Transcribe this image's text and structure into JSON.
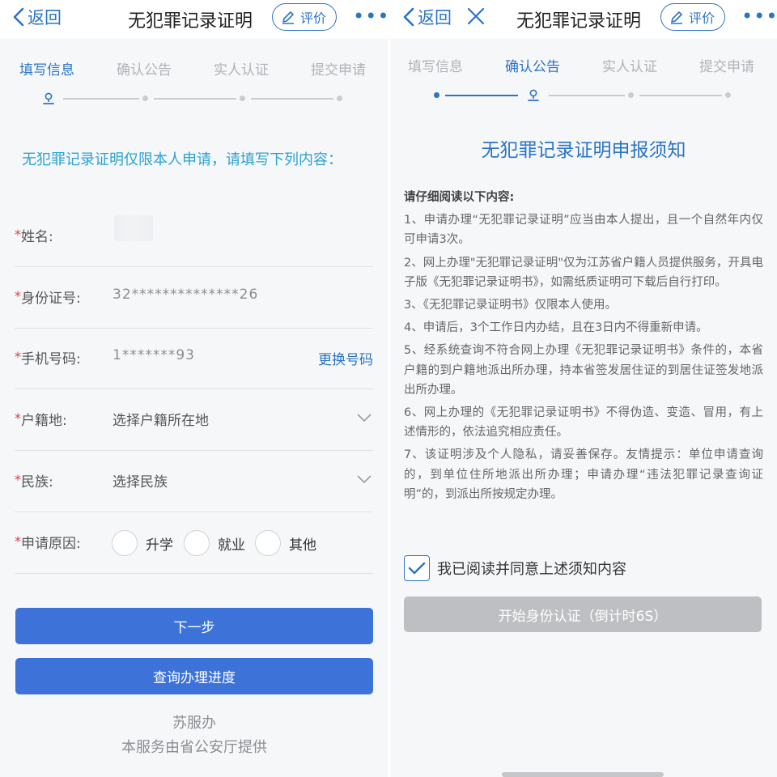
{
  "left": {
    "nav": {
      "back_label": "返回",
      "title": "无犯罪记录证明",
      "rate_label": "评价",
      "more_label": "•••"
    },
    "steps": [
      "填写信息",
      "确认公告",
      "实人认证",
      "提交申请"
    ],
    "intro": "无犯罪记录证明仅限本人申请，请填写下列内容：",
    "form": {
      "required_mark": "*",
      "name_label": "姓名:",
      "id_label": "身份证号:",
      "id_value": "32**************26",
      "phone_label": "手机号码:",
      "phone_value": "1*******93",
      "change_phone": "更换号码",
      "household_label": "户籍地:",
      "household_placeholder": "选择户籍所在地",
      "ethnic_label": "民族:",
      "ethnic_placeholder": "选择民族",
      "reason_label": "申请原因:",
      "reason_options": [
        "升学",
        "就业",
        "其他"
      ]
    },
    "next_button": "下一步",
    "progress_button": "查询办理进度",
    "footer_brand": "苏服办",
    "footer_note": "本服务由省公安厅提供"
  },
  "right": {
    "nav": {
      "back_label": "返回",
      "title": "无犯罪记录证明",
      "rate_label": "评价",
      "more_label": "•••"
    },
    "steps": [
      "填写信息",
      "确认公告",
      "实人认证",
      "提交申请"
    ],
    "notice_title": "无犯罪记录证明申报须知",
    "notice_heading": "请仔细阅读以下内容:",
    "notice_items": [
      "1、申请办理“无犯罪记录证明”应当由本人提出，且一个自然年内仅可申请3次。",
      "2、网上办理\"无犯罪记录证明\"仅为江苏省户籍人员提供服务，开具电子版《无犯罪记录证明书》，如需纸质证明可下载后自行打印。",
      "3、《无犯罪记录证明书》仅限本人使用。",
      "4、申请后，3个工作日内办结，且在3日内不得重新申请。",
      "5、经系统查询不符合网上办理《无犯罪记录证明书》条件的，本省户籍的到户籍地派出所办理，持本省签发居住证的到居住证签发地派出所办理。",
      "6、网上办理的《无犯罪记录证明书》不得伪造、变造、冒用，有上述情形的，依法追究相应责任。",
      "7、该证明涉及个人隐私，请妥善保存。友情提示：单位申请查询的，到单位住所地派出所办理；申请办理“违法犯罪记录查询证明”的，到派出所按规定办理。"
    ],
    "agree_label": "我已阅读并同意上述须知内容",
    "start_button": "开始身份认证（倒计时6S）"
  },
  "colors": {
    "accent": "#2b74c7",
    "primary_button": "#3d73d9",
    "required": "#e23a3a",
    "intro_text": "#2da2d4",
    "disabled_button": "#bdbfc2"
  },
  "icons": {
    "back": "chevron-left-icon",
    "rate": "edit-icon",
    "more": "more-dots-icon",
    "close": "close-icon",
    "step_current": "location-pin-icon",
    "select": "chevron-down-icon",
    "agree": "checkmark-icon"
  }
}
